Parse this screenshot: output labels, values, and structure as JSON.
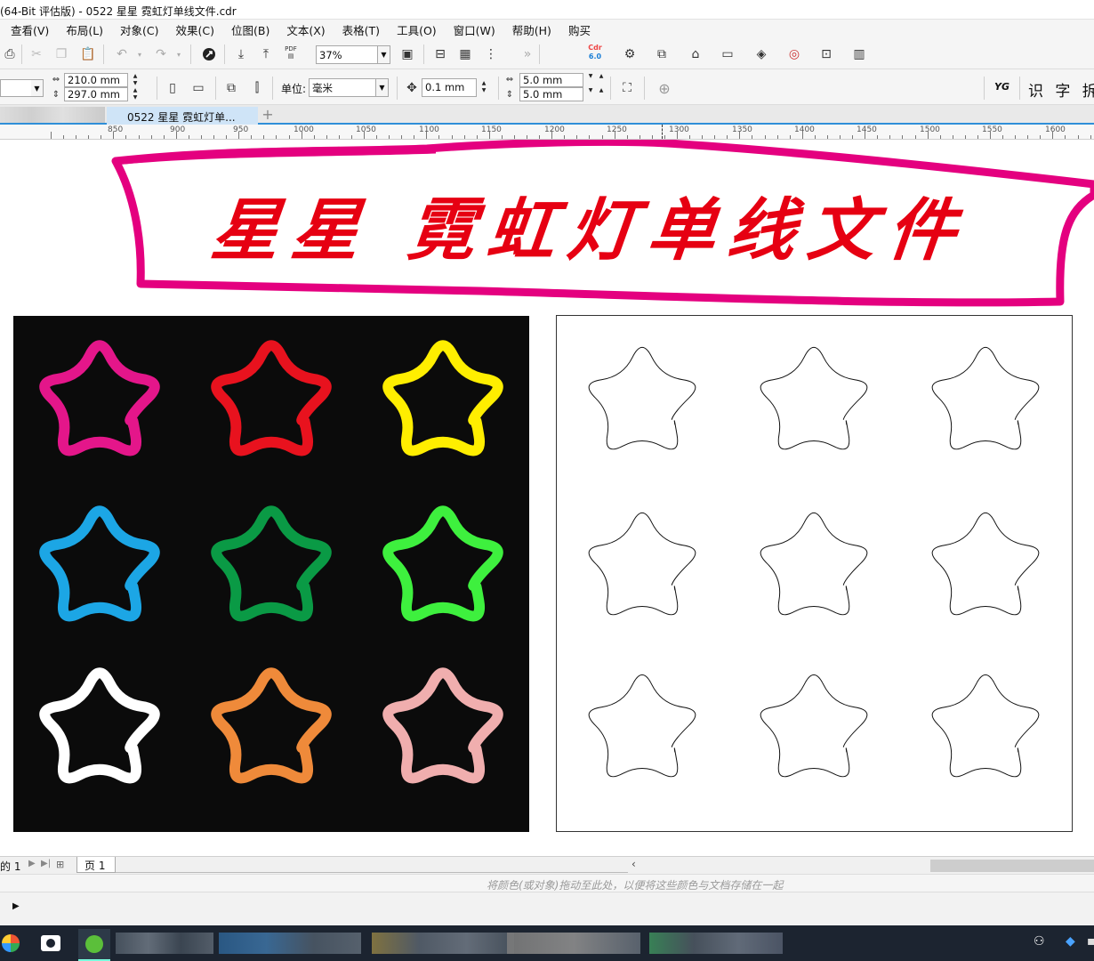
{
  "window": {
    "title": "(64-Bit 评估版) - 0522 星星 霓虹灯单线文件.cdr"
  },
  "menu": [
    "查看(V)",
    "布局(L)",
    "对象(C)",
    "效果(C)",
    "位图(B)",
    "文本(X)",
    "表格(T)",
    "工具(O)",
    "窗口(W)",
    "帮助(H)",
    "购买"
  ],
  "toolbar1": {
    "zoom_value": "37%",
    "pdf_label": "PDF",
    "corel_label": "Cdr",
    "corel_version": "6.0"
  },
  "toolbar2": {
    "page_width": "210.0 mm",
    "page_height": "297.0 mm",
    "unit_label": "单位:",
    "unit_value": "毫米",
    "nudge_value": "0.1 mm",
    "dup_x": "5.0 mm",
    "dup_y": "5.0 mm",
    "plugin_label": "YG",
    "plugin_text": "识 字 拆"
  },
  "doc_tab": {
    "label": "0522 星星 霓虹灯单..."
  },
  "ruler": {
    "labels": [
      "850",
      "900",
      "950",
      "1000",
      "1050",
      "1100",
      "1150",
      "1200",
      "1250",
      "1300",
      "1350",
      "1400",
      "1450",
      "1500",
      "1550",
      "1600"
    ]
  },
  "artwork": {
    "banner_text": "星星 霓虹灯单线文件",
    "banner_color": "#e4007f",
    "text_color": "#e60012",
    "panel_bg": "#0b0b0b",
    "star_colors": [
      "#e4168a",
      "#e8121e",
      "#ffee00",
      "#1ca6e5",
      "#0a9a45",
      "#3ef03e",
      "#ffffff",
      "#ef8a3a",
      "#f0aeae"
    ],
    "outline_stars_count": 9
  },
  "page_nav": {
    "counter": "的 1",
    "page_tab": "页 1"
  },
  "palette_hint": "将颜色(或对象)拖动至此处，以便将这些颜色与文档存储在一起"
}
